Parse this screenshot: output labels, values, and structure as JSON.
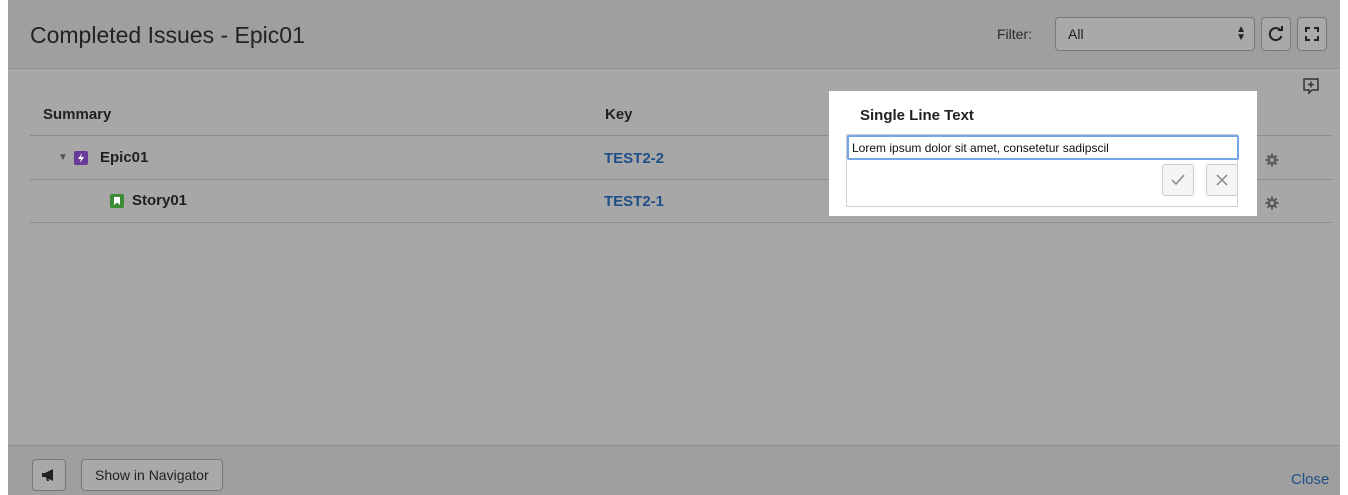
{
  "dialog": {
    "title": "Completed Issues - Epic01",
    "filter": {
      "label": "Filter:",
      "selected": "All"
    }
  },
  "table": {
    "headers": {
      "summary": "Summary",
      "key": "Key"
    },
    "rows": [
      {
        "summary": "Epic01",
        "key": "TEST2-2",
        "type": "epic-icon"
      },
      {
        "summary": "Story01",
        "key": "TEST2-1",
        "type": "story-icon"
      }
    ]
  },
  "editor": {
    "title": "Single Line Text",
    "value": "Lorem ipsum dolor sit amet, consetetur sadipscil"
  },
  "footer": {
    "navigator_label": "Show in Navigator",
    "close_label": "Close"
  },
  "colors": {
    "link": "#1e4e87",
    "epic": "#6a3a9a",
    "story": "#3b8a36",
    "focus": "#74a6e6"
  }
}
